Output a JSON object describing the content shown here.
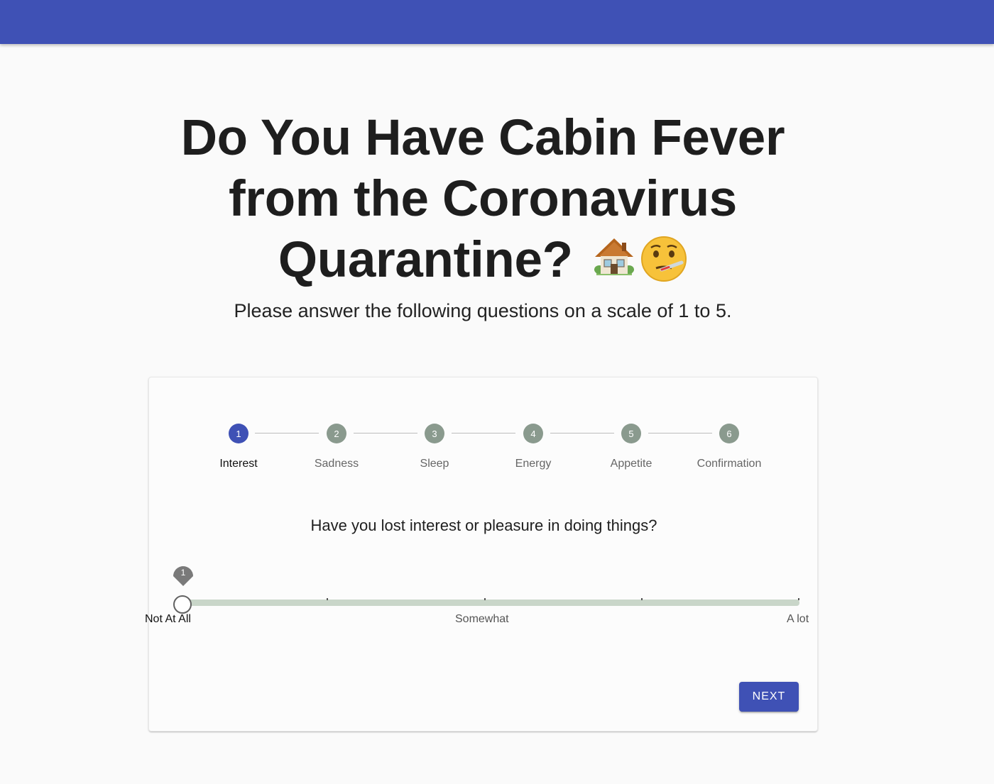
{
  "colors": {
    "primary": "#3f51b5",
    "app_bar": "#3f51b5",
    "step_inactive": "#8a9a8e",
    "slider_track": "#c9d6c9",
    "slider_thumb_border": "#616161",
    "value_pin": "#7a7a7a"
  },
  "header": {
    "title_text": "Do You Have Cabin Fever from the Coronavirus Quarantine?",
    "title_emoji_icons": [
      "house-with-garden-icon",
      "face-with-thermometer-icon"
    ],
    "subtitle": "Please answer the following questions on a scale of 1 to 5."
  },
  "stepper": {
    "active_index": 0,
    "steps": [
      {
        "number": "1",
        "label": "Interest"
      },
      {
        "number": "2",
        "label": "Sadness"
      },
      {
        "number": "3",
        "label": "Sleep"
      },
      {
        "number": "4",
        "label": "Energy"
      },
      {
        "number": "5",
        "label": "Appetite"
      },
      {
        "number": "6",
        "label": "Confirmation"
      }
    ]
  },
  "question": {
    "text": "Have you lost interest or pleasure in doing things?",
    "slider": {
      "min": 1,
      "max": 5,
      "value": 1,
      "value_label": "1",
      "marks": {
        "low": "Not At All",
        "mid": "Somewhat",
        "high": "A lot"
      }
    }
  },
  "actions": {
    "next_label": "NEXT"
  }
}
